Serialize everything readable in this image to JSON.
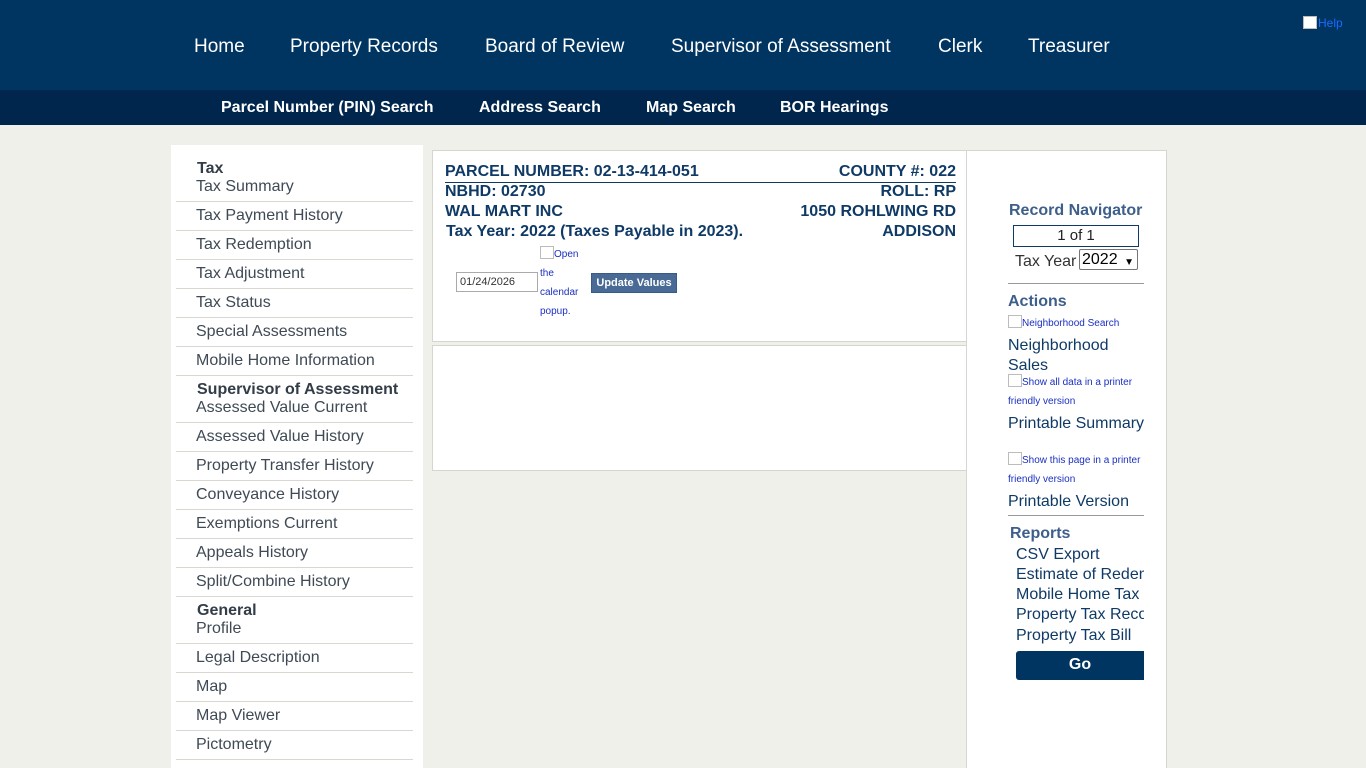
{
  "top_nav": {
    "items": [
      "Home",
      "Property Records",
      "Board of Review",
      "Supervisor of Assessment",
      "Clerk",
      "Treasurer"
    ],
    "help_alt": "Help"
  },
  "sub_nav": {
    "items": [
      "Parcel Number (PIN) Search",
      "Address Search",
      "Map Search",
      "BOR Hearings"
    ]
  },
  "sidebar": {
    "groups": [
      {
        "header": "Tax",
        "items": [
          "Tax Summary",
          "Tax Payment History",
          "Tax Redemption",
          "Tax Adjustment",
          "Tax Status",
          "Special Assessments",
          "Mobile Home Information"
        ]
      },
      {
        "header": "Supervisor of Assessment",
        "items": [
          "Assessed Value Current",
          "Assessed Value History",
          "Property Transfer History",
          "Conveyance History",
          "Exemptions Current",
          "Appeals History",
          "Split/Combine History"
        ]
      },
      {
        "header": "General",
        "items": [
          "Profile",
          "Legal Description",
          "Map",
          "Map Viewer",
          "Pictometry"
        ]
      }
    ]
  },
  "parcel": {
    "parcel_number": "PARCEL NUMBER: 02-13-414-051",
    "county": "COUNTY #: 022",
    "nbhd": "NBHD: 02730",
    "roll": "ROLL: RP",
    "owner": "WAL MART INC",
    "address": "1050 ROHLWING RD",
    "tax_year": "Tax Year: 2022 (Taxes Payable in 2023).",
    "city": "ADDISON",
    "date_value": "01/24/2026",
    "calendar_alt": "Open the calendar popup.",
    "update_button": "Update Values"
  },
  "right_panel": {
    "record_navigator_title": "Record Navigator",
    "record_position": "1 of 1",
    "tax_year_label": "Tax Year",
    "tax_year_selected": "2022",
    "actions_title": "Actions",
    "actions": [
      {
        "img_alt": "Neighborhood Search",
        "label": "Neighborhood Sales"
      },
      {
        "img_alt": "Show all data in a printer friendly version",
        "label": "Printable Summary"
      },
      {
        "img_alt": "Show this page in a printer friendly version",
        "label": "Printable Version"
      }
    ],
    "reports_title": "Reports",
    "reports": [
      "CSV Export",
      "Estimate of Redemption",
      "Mobile Home Tax",
      "Property Tax Record",
      "Property Tax Bill"
    ],
    "go_button": "Go"
  }
}
